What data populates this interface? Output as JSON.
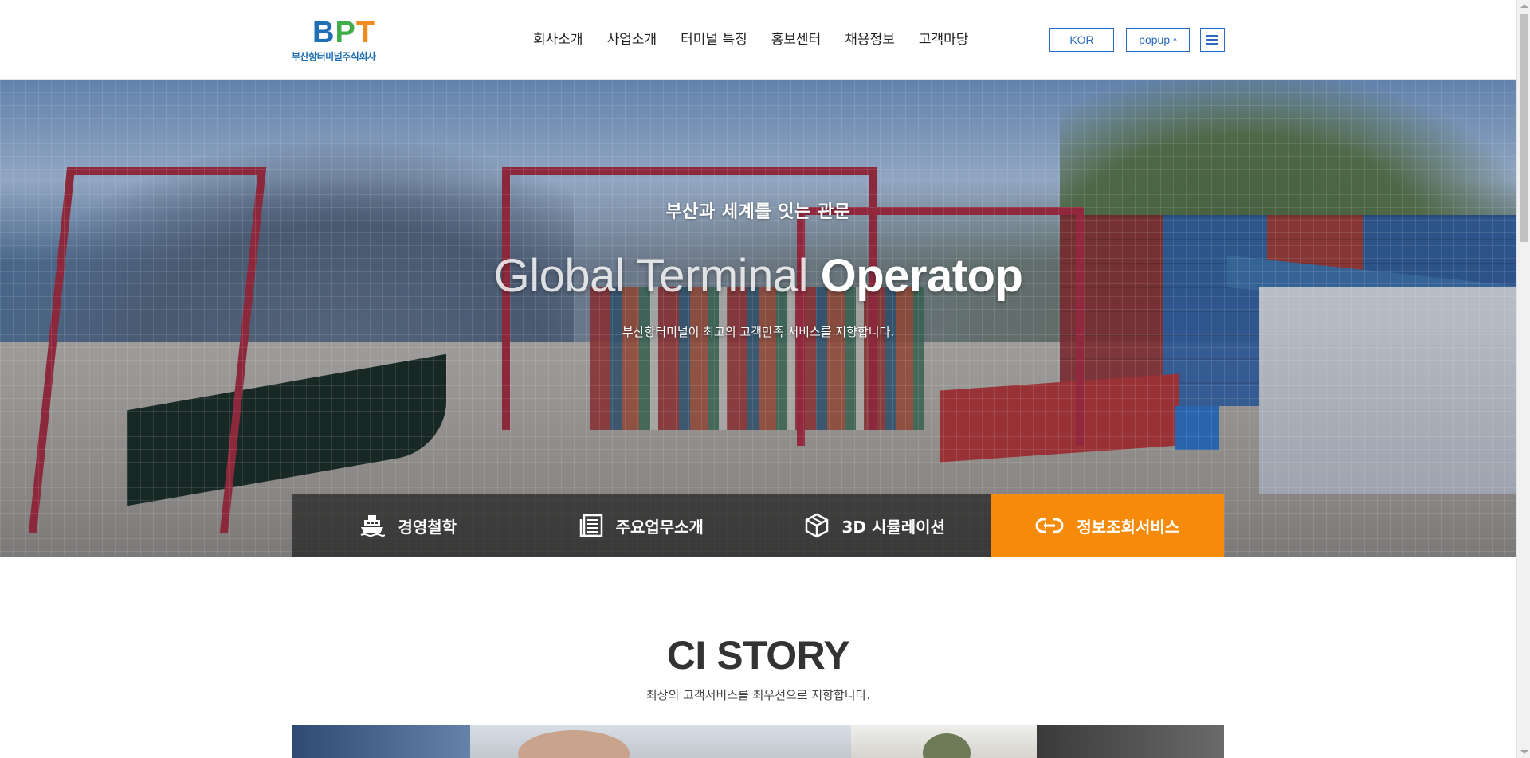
{
  "header": {
    "logo": {
      "mark_b": "B",
      "mark_p": "P",
      "mark_t": "T",
      "subtitle": "부산항터미널주식회사"
    },
    "nav": [
      "회사소개",
      "사업소개",
      "터미널 특징",
      "홍보센터",
      "채용정보",
      "고객마당"
    ],
    "lang_label": "KOR",
    "popup_label": "popup",
    "popup_caret": "^",
    "menu_icon": "hamburger-icon"
  },
  "hero": {
    "eyebrow": "부산과 세계를 잇는 관문",
    "title_light": "Global Terminal ",
    "title_bold": "Operatop",
    "description": "부산항터미널이 최고의 고객만족 서비스를 지향합니다.",
    "quick_links": [
      {
        "label": "경영철학",
        "icon": "ship-icon"
      },
      {
        "label": "주요업무소개",
        "icon": "document-icon"
      },
      {
        "label": "3D 시뮬레이션",
        "icon": "cube-icon"
      },
      {
        "label": "정보조회서비스",
        "icon": "link-icon",
        "active": true
      }
    ]
  },
  "ci_story": {
    "title": "CI STORY",
    "subtitle": "최상의 고객서비스를 최우선으로 지향합니다."
  },
  "colors": {
    "brand_blue": "#2a6bbf",
    "accent_orange": "#f58a0b",
    "logo_blue": "#1e6fb4",
    "logo_green": "#3fae49",
    "logo_orange": "#f08c1e"
  }
}
